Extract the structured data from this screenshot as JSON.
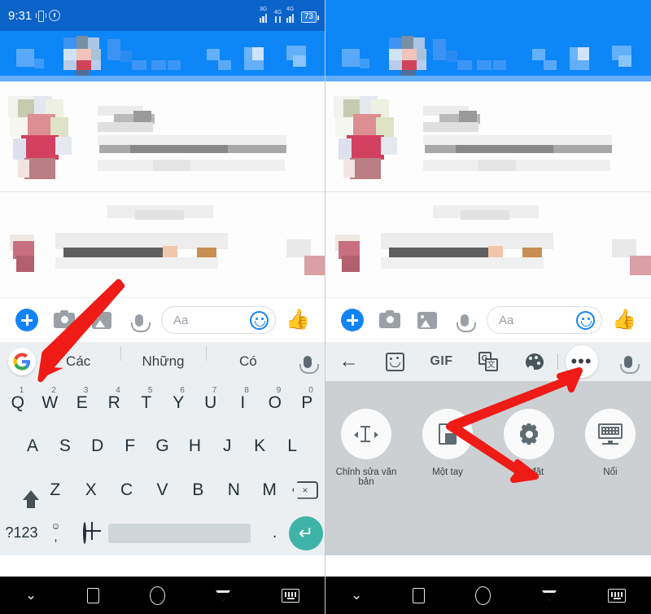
{
  "status_bar": {
    "time": "9:31",
    "vibrate_icon": "vibrate-icon",
    "alarm_icon": "alarm-icon",
    "signal_1_label": "3G",
    "signal_2_label": "4G",
    "signal_3_label": "4G",
    "battery_level": "73"
  },
  "compose_bar": {
    "plus_icon": "plus-icon",
    "camera_icon": "camera-icon",
    "gallery_icon": "gallery-icon",
    "mic_icon": "microphone-icon",
    "input_placeholder": "Aa",
    "emoji_icon": "smiley-icon",
    "like_icon": "thumbs-up-icon",
    "like_glyph": "👍"
  },
  "left_panel": {
    "suggestion_strip": {
      "google_logo": "google-logo",
      "google_glyph": "G",
      "suggestions": [
        "Các",
        "Những",
        "Có"
      ],
      "mic_icon": "microphone-icon"
    },
    "keyboard": {
      "row1": [
        {
          "letter": "Q",
          "num": "1"
        },
        {
          "letter": "W",
          "num": "2"
        },
        {
          "letter": "E",
          "num": "3"
        },
        {
          "letter": "R",
          "num": "4"
        },
        {
          "letter": "T",
          "num": "5"
        },
        {
          "letter": "Y",
          "num": "6"
        },
        {
          "letter": "U",
          "num": "7"
        },
        {
          "letter": "I",
          "num": "8"
        },
        {
          "letter": "O",
          "num": "9"
        },
        {
          "letter": "P",
          "num": "0"
        }
      ],
      "row2": [
        "A",
        "S",
        "D",
        "F",
        "G",
        "H",
        "J",
        "K",
        "L"
      ],
      "row3": [
        "Z",
        "X",
        "C",
        "V",
        "B",
        "N",
        "M"
      ],
      "shift_icon": "shift-icon",
      "backspace_icon": "backspace-icon",
      "backspace_glyph": "×",
      "symbols_key": "?123",
      "comma_key": ",",
      "emoji_key_glyph": "☺",
      "globe_icon": "globe-icon",
      "space_key": "",
      "period_key": ".",
      "enter_icon": "enter-icon",
      "enter_glyph": "↵"
    }
  },
  "right_panel": {
    "gboard_toolbar": {
      "back_icon": "back-arrow-icon",
      "back_glyph": "←",
      "sticker_icon": "sticker-icon",
      "gif_label": "GIF",
      "translate_icon": "translate-icon",
      "translate_glyph_1": "G",
      "translate_glyph_2": "文",
      "theme_icon": "palette-icon",
      "more_icon": "more-options-icon",
      "more_glyph": "•••",
      "mic_icon": "microphone-icon"
    },
    "options": [
      {
        "label": "Chỉnh sửa văn bản",
        "icon": "text-editing-icon"
      },
      {
        "label": "Một tay",
        "icon": "one-handed-mode-icon"
      },
      {
        "label": "Cài đặt",
        "icon": "settings-gear-icon"
      },
      {
        "label": "Nổi",
        "icon": "floating-keyboard-icon"
      }
    ]
  },
  "nav_bar": {
    "hide_keyboard_icon": "chevron-down-icon",
    "hide_keyboard_glyph": "⌄",
    "recents_icon": "recents-square-icon",
    "home_icon": "home-circle-icon",
    "back_icon": "back-triangle-icon",
    "switch_keyboard_icon": "keyboard-switch-icon"
  },
  "annotations": {
    "arrow_color": "#ee1b17",
    "left_arrow_target": "google-logo",
    "right_arrow_1_target": "more-options-icon",
    "right_arrow_2_target": "settings-gear-icon"
  },
  "colors": {
    "status_bar_bg": "#0a63c9",
    "app_header_bg": "#0d86f7",
    "messenger_blue": "#1384f7",
    "keyboard_bg": "#eceff1",
    "options_panel_bg": "#ccd0d2",
    "enter_key_teal": "#3fb3a8",
    "nav_bar_bg": "#000000"
  }
}
